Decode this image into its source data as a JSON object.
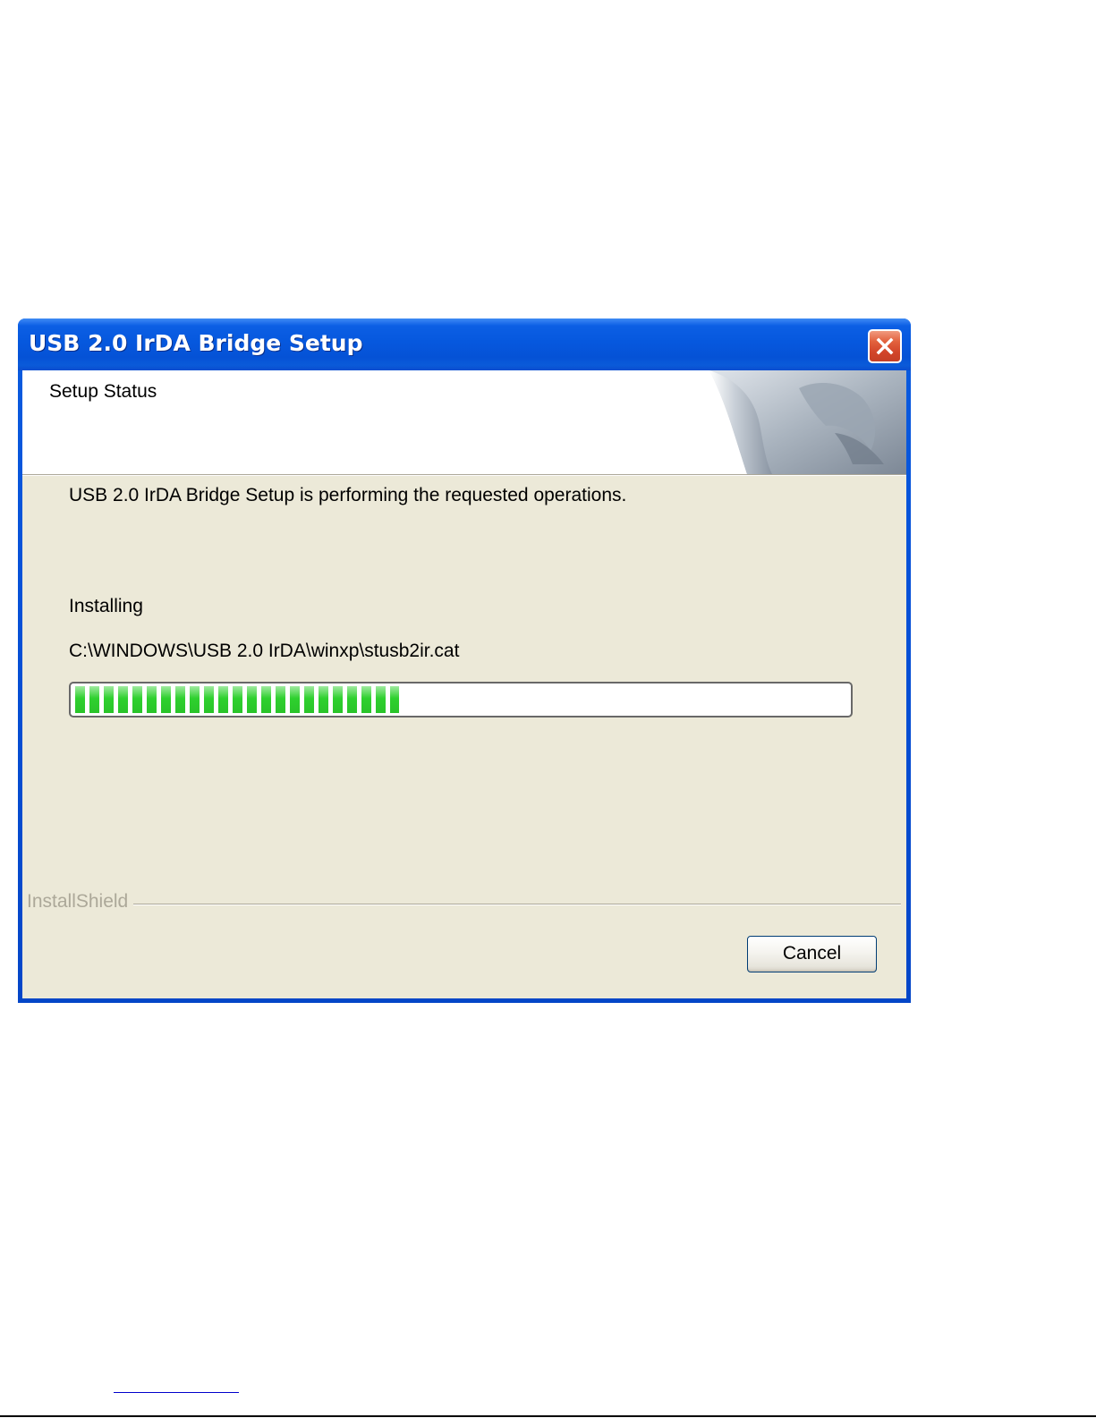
{
  "window": {
    "title": "USB 2.0 IrDA Bridge Setup",
    "close_icon": "close-icon"
  },
  "header": {
    "title": "Setup Status",
    "art_icon": "installshield-page-curl-graphic"
  },
  "body": {
    "description": "USB 2.0 IrDA Bridge Setup is performing the requested operations.",
    "status_label": "Installing",
    "file_path": "C:\\WINDOWS\\USB 2.0 IrDA\\winxp\\stusb2ir.cat",
    "progress_fraction": 0.42
  },
  "footer": {
    "brand": "InstallShield",
    "cancel_label": "Cancel"
  },
  "colors": {
    "titlebar": "#0658de",
    "client_bg": "#ece9d8",
    "progress_fill": "#2fd12f",
    "brand_text": "#aca899",
    "close_button": "#e2613d"
  }
}
